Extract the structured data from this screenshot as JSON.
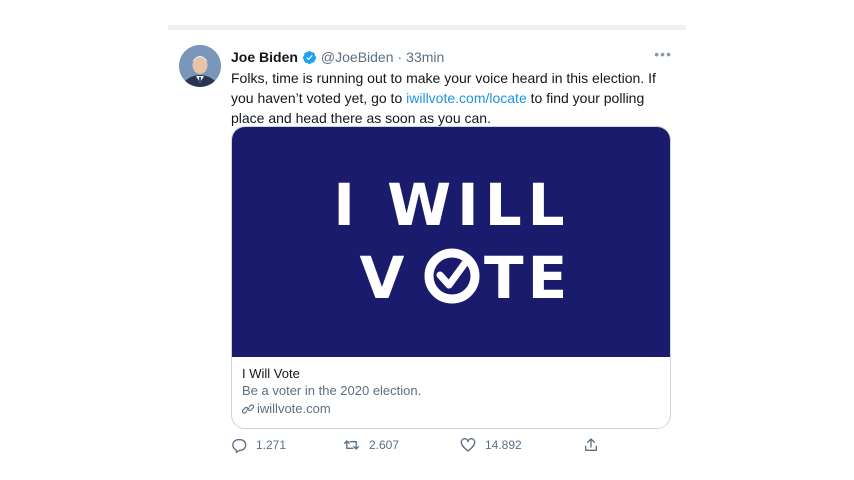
{
  "tweet": {
    "author_name": "Joe Biden",
    "handle": "@JoeBiden",
    "separator": "·",
    "time": "33min",
    "more": "•••",
    "text_before_link": "Folks, time is running out to make your voice heard in this election. If you haven’t voted yet, go to ",
    "link_text": "iwillvote.com/locate",
    "text_after_link": " to find your polling place and head there as soon as you can."
  },
  "card": {
    "image_line1": "I WILL",
    "image_line2_prefix": "V",
    "image_line2_suffix": "TE",
    "title": "I Will Vote",
    "description": "Be a voter in the 2020 election.",
    "url": "iwillvote.com",
    "image_bg": "#1b1b6e"
  },
  "actions": {
    "replies": "1.271",
    "retweets": "2.607",
    "likes": "14.892"
  },
  "colors": {
    "link": "#1b95e0",
    "verified": "#1da1f2",
    "muted": "#5b7083"
  }
}
